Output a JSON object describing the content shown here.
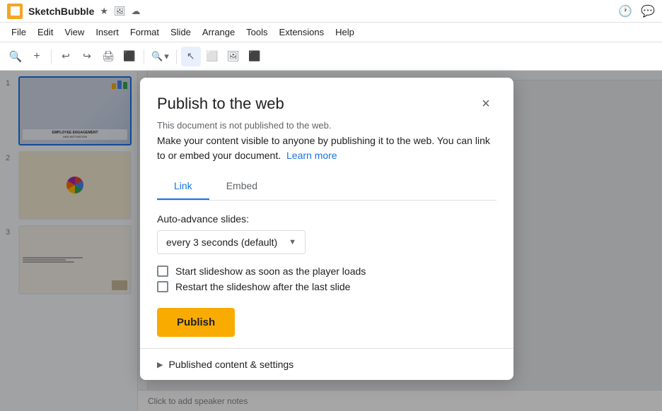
{
  "app": {
    "name": "SketchBubble",
    "icon_bg": "#f4a522"
  },
  "title_icons": [
    "★",
    "🖼",
    "☁"
  ],
  "top_bar_right_icons": [
    "🕐",
    "💬"
  ],
  "menu": {
    "items": [
      "File",
      "Edit",
      "View",
      "Insert",
      "Format",
      "Slide",
      "Arrange",
      "Tools",
      "Extensions",
      "Help"
    ]
  },
  "toolbar": {
    "buttons": [
      "🔍",
      "+",
      "↩",
      "↪",
      "🖨",
      "⬛",
      "🔍",
      "▾",
      "↑",
      "⬛",
      "⬛",
      "⬛"
    ]
  },
  "slides": [
    {
      "num": "1",
      "label": "Slide 1",
      "active": true
    },
    {
      "num": "2",
      "label": "Slide 2",
      "active": false
    },
    {
      "num": "3",
      "label": "Slide 3",
      "active": false
    }
  ],
  "speaker_note": "Click to add speaker notes",
  "dialog": {
    "title": "Publish to the web",
    "close_label": "×",
    "info_line1": "This document is not published to the web.",
    "info_line2": "Make your content visible to anyone by publishing it to the web. You can link to or embed your document.",
    "learn_more": "Learn more",
    "tabs": [
      {
        "id": "link",
        "label": "Link",
        "active": true
      },
      {
        "id": "embed",
        "label": "Embed",
        "active": false
      }
    ],
    "auto_advance_label": "Auto-advance slides:",
    "dropdown_value": "every 3 seconds (default)",
    "dropdown_arrow": "▼",
    "checkboxes": [
      {
        "id": "autostart",
        "label": "Start slideshow as soon as the player loads"
      },
      {
        "id": "restart",
        "label": "Restart the slideshow after the last slide"
      }
    ],
    "publish_button": "Publish",
    "published_section": "Published content & settings",
    "published_section_arrow": "▶"
  }
}
